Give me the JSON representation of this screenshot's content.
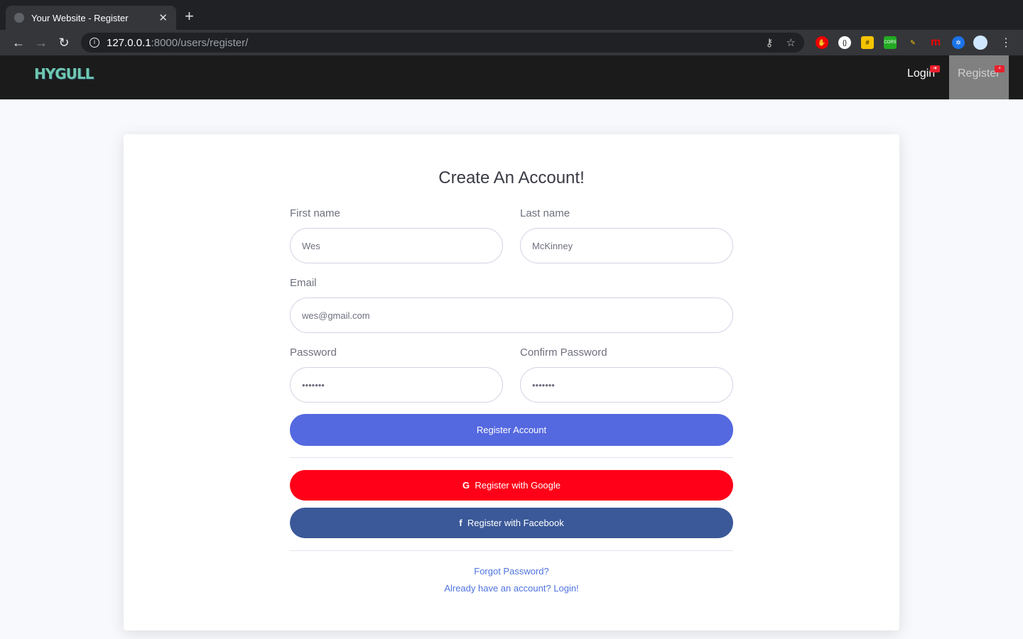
{
  "browser": {
    "tab_title": "Your Website - Register",
    "url_host": "127.0.0.1",
    "url_path": ":8000/users/register/"
  },
  "nav": {
    "logo": "HYGULL",
    "login": "Login",
    "register": "Register"
  },
  "form": {
    "title": "Create An Account!",
    "first_name_label": "First name",
    "first_name": "Wes",
    "last_name_label": "Last name",
    "last_name": "McKinney",
    "email_label": "Email",
    "email": "wes@gmail.com",
    "password_label": "Password",
    "password": "•••••••",
    "confirm_label": "Confirm Password",
    "confirm": "•••••••",
    "register_button": "Register Account",
    "google_button": "Register with Google",
    "facebook_button": "Register with Facebook",
    "forgot": "Forgot Password?",
    "login_link": "Already have an account? Login!"
  },
  "colors": {
    "primary": "#5468e0",
    "google": "#ff0018",
    "facebook": "#3b5998"
  }
}
